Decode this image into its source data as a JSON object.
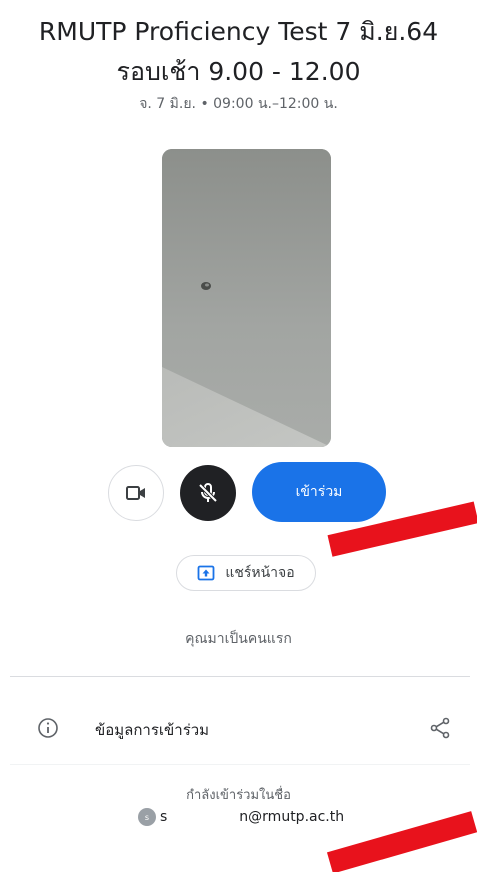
{
  "meeting": {
    "title_line1": "RMUTP Proficiency Test 7 มิ.ย.64",
    "title_line2": "รอบเช้า 9.00 - 12.00",
    "schedule": "จ. 7 มิ.ย. • 09:00 น.–12:00 น."
  },
  "controls": {
    "camera_icon": "videocam-icon",
    "mic_icon": "mic-off-icon",
    "join_label": "เข้าร่วม"
  },
  "share_screen": {
    "icon": "present-to-all-icon",
    "label": "แชร์หน้าจอ"
  },
  "status": {
    "first_participant": "คุณมาเป็นคนแรก"
  },
  "joining_info": {
    "icon": "info-icon",
    "label": "ข้อมูลการเข้าร่วม",
    "share_icon": "share-icon"
  },
  "account": {
    "joining_as": "กำลังเข้าร่วมในชื่อ",
    "avatar_letter": "s",
    "email_prefix": "s",
    "email_visible": "n@rmutp.ac.th"
  },
  "colors": {
    "join_button": "#1a73e8",
    "mic_button": "#202124",
    "redaction_mark": "#e8121c"
  }
}
